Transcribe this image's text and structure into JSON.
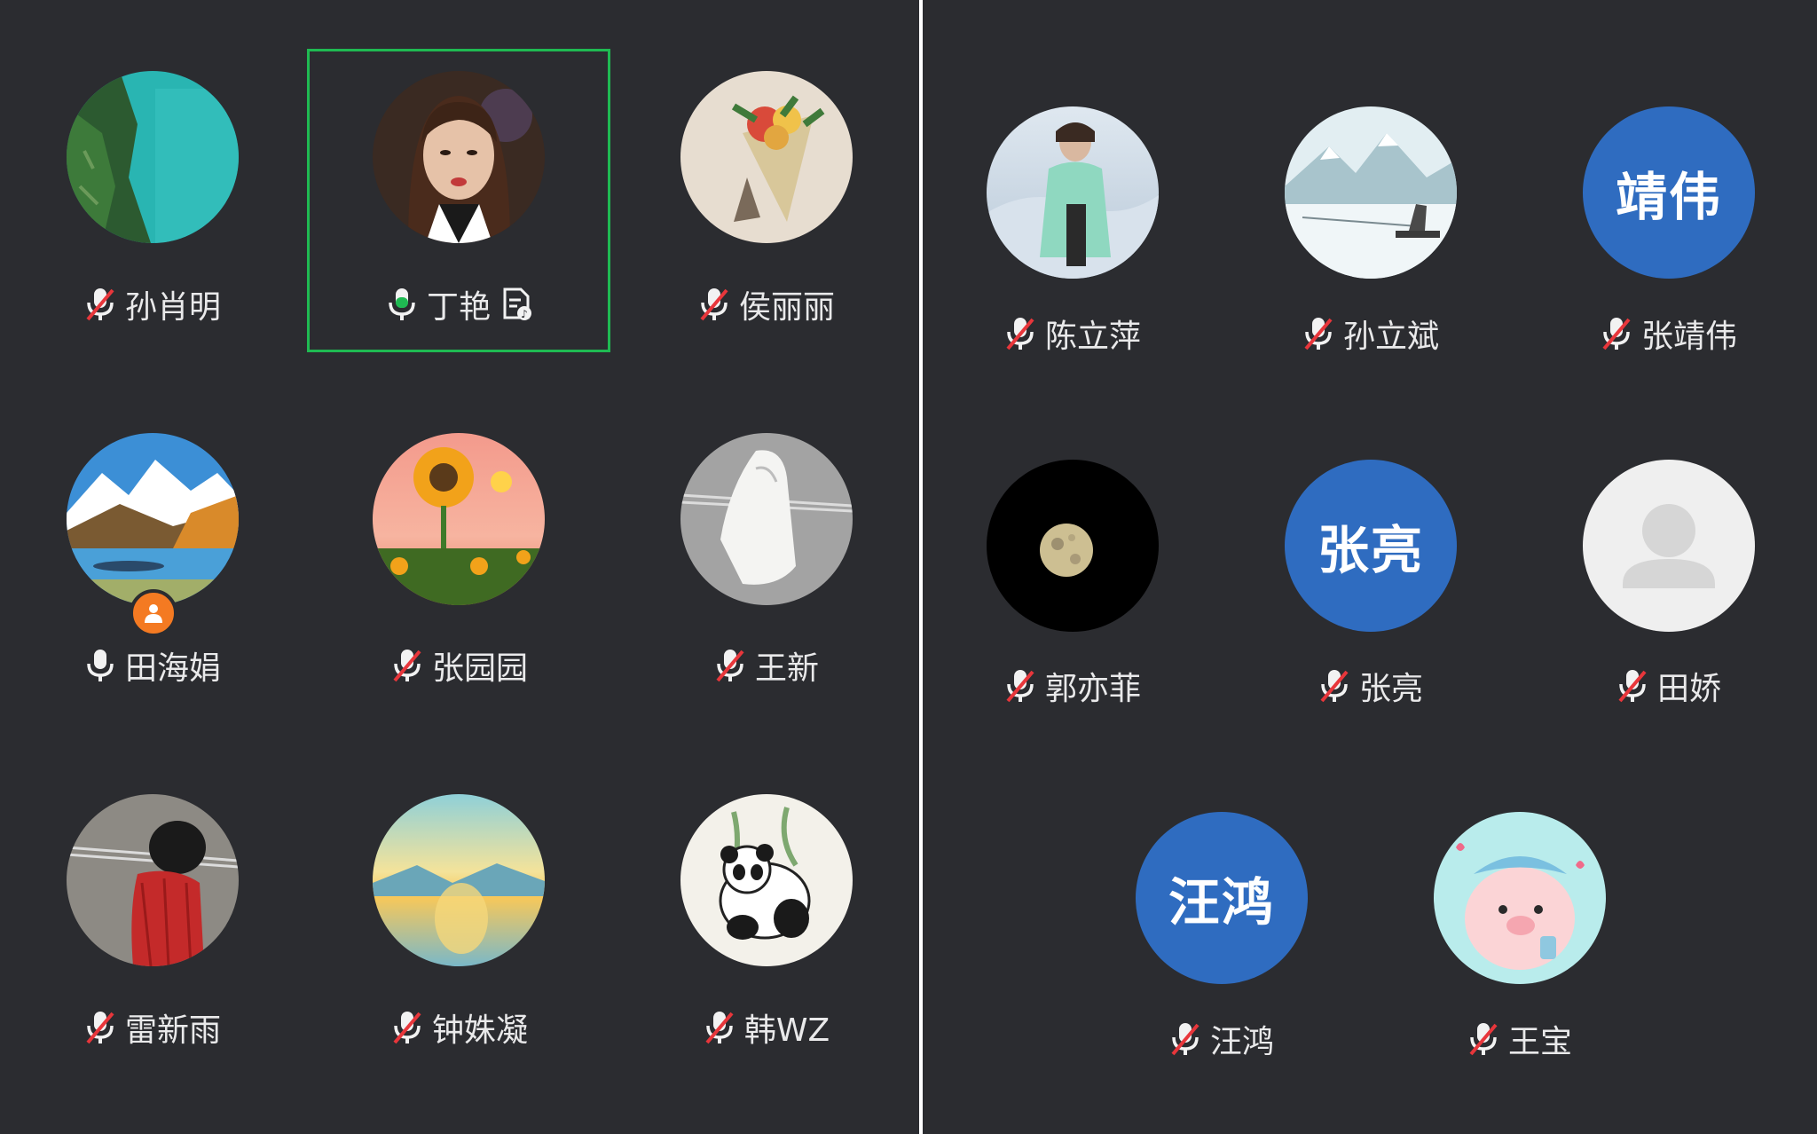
{
  "meeting": {
    "left_page": {
      "participants": [
        {
          "name": "孙肖明",
          "mic": "muted",
          "avatar": "photo-turquoise-lake-cliff"
        },
        {
          "name": "丁艳",
          "mic": "speaking",
          "avatar": "photo-woman-portrait",
          "active_speaker": true,
          "doc_icon": "document-share-icon"
        },
        {
          "name": "侯丽丽",
          "mic": "muted",
          "avatar": "photo-flower-bouquet"
        },
        {
          "name": "田海娟",
          "mic": "unmuted",
          "avatar": "photo-mountain-lake",
          "host_badge": "host-person-icon"
        },
        {
          "name": "张园园",
          "mic": "muted",
          "avatar": "photo-sunflower-sunset"
        },
        {
          "name": "王新",
          "mic": "muted",
          "avatar": "illustration-white-hoodie"
        },
        {
          "name": "雷新雨",
          "mic": "muted",
          "avatar": "illustration-red-sweater"
        },
        {
          "name": "钟姝凝",
          "mic": "muted",
          "avatar": "painting-lake-sunrise"
        },
        {
          "name": "韩WZ",
          "mic": "muted",
          "avatar": "illustration-panda"
        }
      ]
    },
    "right_page": {
      "participants": [
        {
          "name": "陈立萍",
          "mic": "muted",
          "avatar": "photo-woman-green-coat"
        },
        {
          "name": "孙立斌",
          "mic": "muted",
          "avatar": "painting-snow-mountains-fisher"
        },
        {
          "name": "张靖伟",
          "mic": "muted",
          "avatar_text": "靖伟"
        },
        {
          "name": "郭亦菲",
          "mic": "muted",
          "avatar": "photo-moon"
        },
        {
          "name": "张亮",
          "mic": "muted",
          "avatar_text": "张亮"
        },
        {
          "name": "田娇",
          "mic": "muted",
          "avatar": "default-person-placeholder"
        },
        {
          "name": "汪鸿",
          "mic": "muted",
          "avatar_text": "汪鸿"
        },
        {
          "name": "王宝",
          "mic": "muted",
          "avatar": "illustration-pink-pig"
        }
      ]
    }
  },
  "colors": {
    "background": "#2b2c30",
    "active_speaker_border": "#1fba52",
    "muted_slash": "#e8363b",
    "text_avatar_bg": "#2f6cc0",
    "host_badge": "#f47a22"
  }
}
